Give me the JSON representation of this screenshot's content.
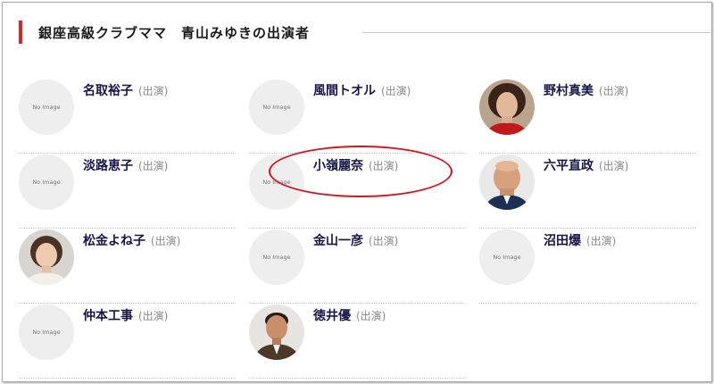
{
  "heading": {
    "title": "銀座高級クラブママ　青山みゆきの出演者"
  },
  "no_image_text": "No Image",
  "cast": [
    {
      "name": "名取裕子",
      "role": "(出演)",
      "photo": false
    },
    {
      "name": "風間トオル",
      "role": "(出演)",
      "photo": false
    },
    {
      "name": "野村真美",
      "role": "(出演)",
      "photo": true,
      "icon": "portrait-woman-icon"
    },
    {
      "name": "淡路恵子",
      "role": "(出演)",
      "photo": false
    },
    {
      "name": "小嶺麗奈",
      "role": "(出演)",
      "photo": false
    },
    {
      "name": "六平直政",
      "role": "(出演)",
      "photo": true,
      "icon": "portrait-man-bald-icon"
    },
    {
      "name": "松金よね子",
      "role": "(出演)",
      "photo": true,
      "icon": "portrait-woman-icon"
    },
    {
      "name": "金山一彦",
      "role": "(出演)",
      "photo": false
    },
    {
      "name": "沼田爆",
      "role": "(出演)",
      "photo": false
    },
    {
      "name": "仲本工事",
      "role": "(出演)",
      "photo": false
    },
    {
      "name": "徳井優",
      "role": "(出演)",
      "photo": true,
      "icon": "portrait-man-icon"
    }
  ],
  "colors": {
    "accent": "#d8232a",
    "name": "#16164a",
    "annotation": "#d4161c"
  }
}
